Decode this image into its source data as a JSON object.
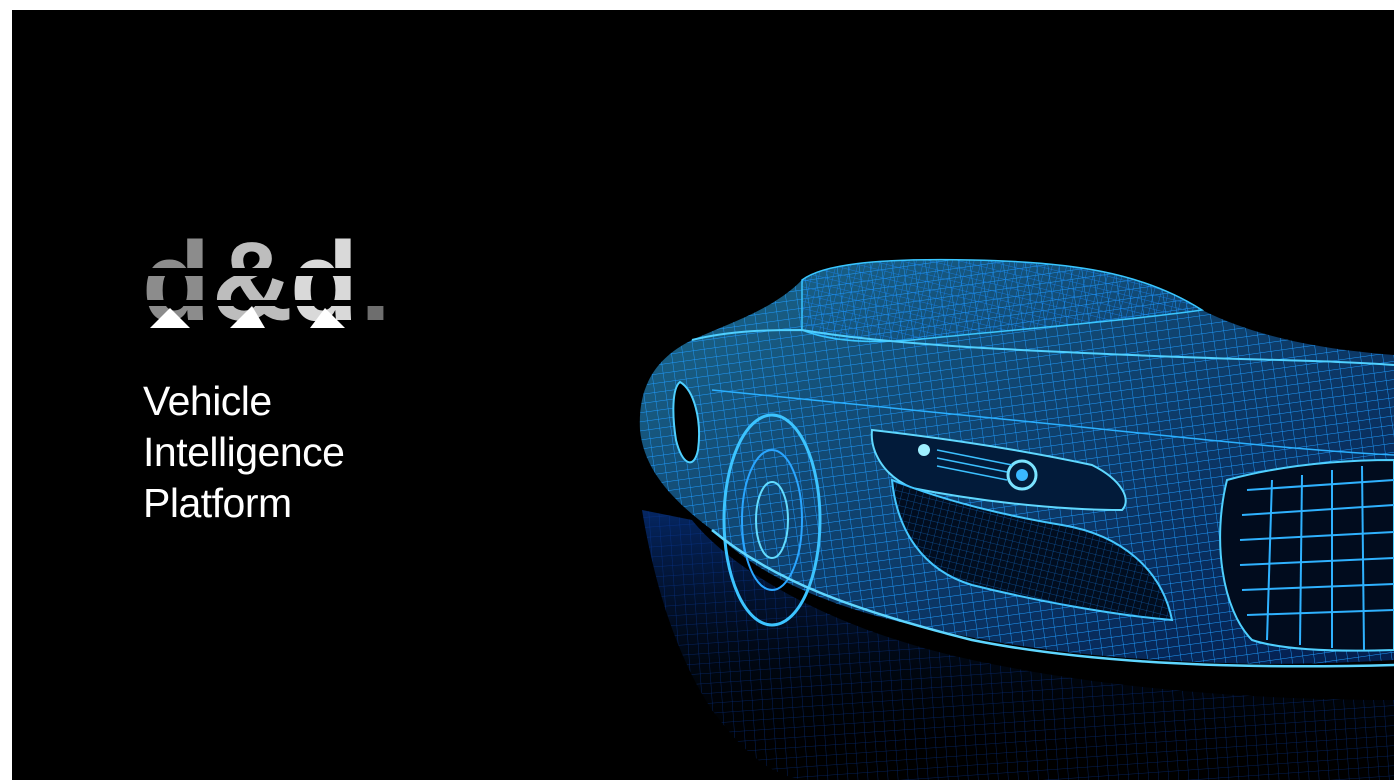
{
  "brand": {
    "logo_text": "d&d.",
    "tagline_lines": [
      "Vehicle",
      "Intelligence",
      "Platform"
    ]
  },
  "hero": {
    "image": "wireframe-car",
    "wire_color": "#1aa8ff",
    "background_color": "#000000"
  }
}
